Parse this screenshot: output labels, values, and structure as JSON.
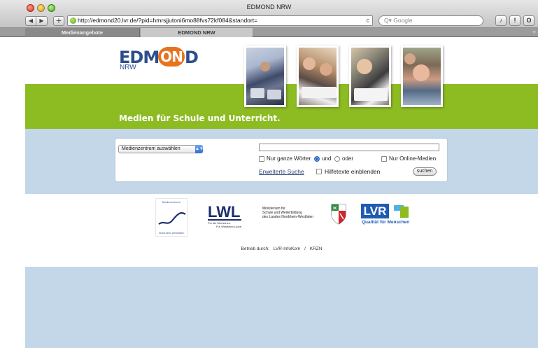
{
  "browser": {
    "window_title": "EDMOND NRW",
    "url": "http://edmond20.lvr.de/?pid=hmrsjjutoni6mo88fvs72kf084&standort=",
    "search_placeholder": "Q▾ Google",
    "nav": {
      "back": "◀",
      "forward": "▶",
      "add": "+",
      "reload": "c"
    },
    "toolbar_right": [
      "♪",
      "!",
      "O"
    ],
    "tabs": [
      {
        "label": "Medienangebote",
        "active": false
      },
      {
        "label": "EDMOND NRW",
        "active": true
      }
    ],
    "new_tab": "+"
  },
  "header": {
    "logo": {
      "part1": "EDM",
      "part2": "ON",
      "part3": "D",
      "sub": "NRW"
    },
    "photos": [
      "photo-classroom-laptops",
      "photo-students-headphones",
      "photo-student-headset",
      "photo-girl-headphones"
    ],
    "tagline": "Medien für Schule und Unterricht."
  },
  "search": {
    "select_value": "Medienzentrum auswählen",
    "query": "",
    "whole_words_label": "Nur ganze Wörter",
    "and_label": "und",
    "or_label": "oder",
    "online_only_label": "Nur Online-Medien",
    "advanced_link": "Erweiterte Suche",
    "help_label": "Hilfetexte einblenden",
    "submit_label": "suchen",
    "and_selected": true
  },
  "partners": {
    "medienzentren_top": "Medienzentren",
    "medienzentren_bottom": "Nordrhein-Westfalen",
    "lwl_name": "LWL",
    "lwl_sub1": "Für die Menschen.",
    "lwl_sub2": "Für Westfalen-Lippe.",
    "ministerium_lines": [
      "Ministerium für",
      "Schule und Weiterbildung",
      "des Landes Nordrhein-Westfalen"
    ],
    "lvr_name": "LVR",
    "lvr_claim": "Qualität für Menschen"
  },
  "footer": {
    "operated_by": "Betrieb durch:",
    "operator1": "LVR-InfoKom",
    "separator": "/",
    "operator2": "KRZN"
  },
  "colors": {
    "brand_green": "#8dbb22",
    "brand_blue": "#2d4e8e",
    "brand_orange": "#e8731e",
    "page_background": "#c3d7e8",
    "lvr_blue": "#1f5bb3"
  }
}
